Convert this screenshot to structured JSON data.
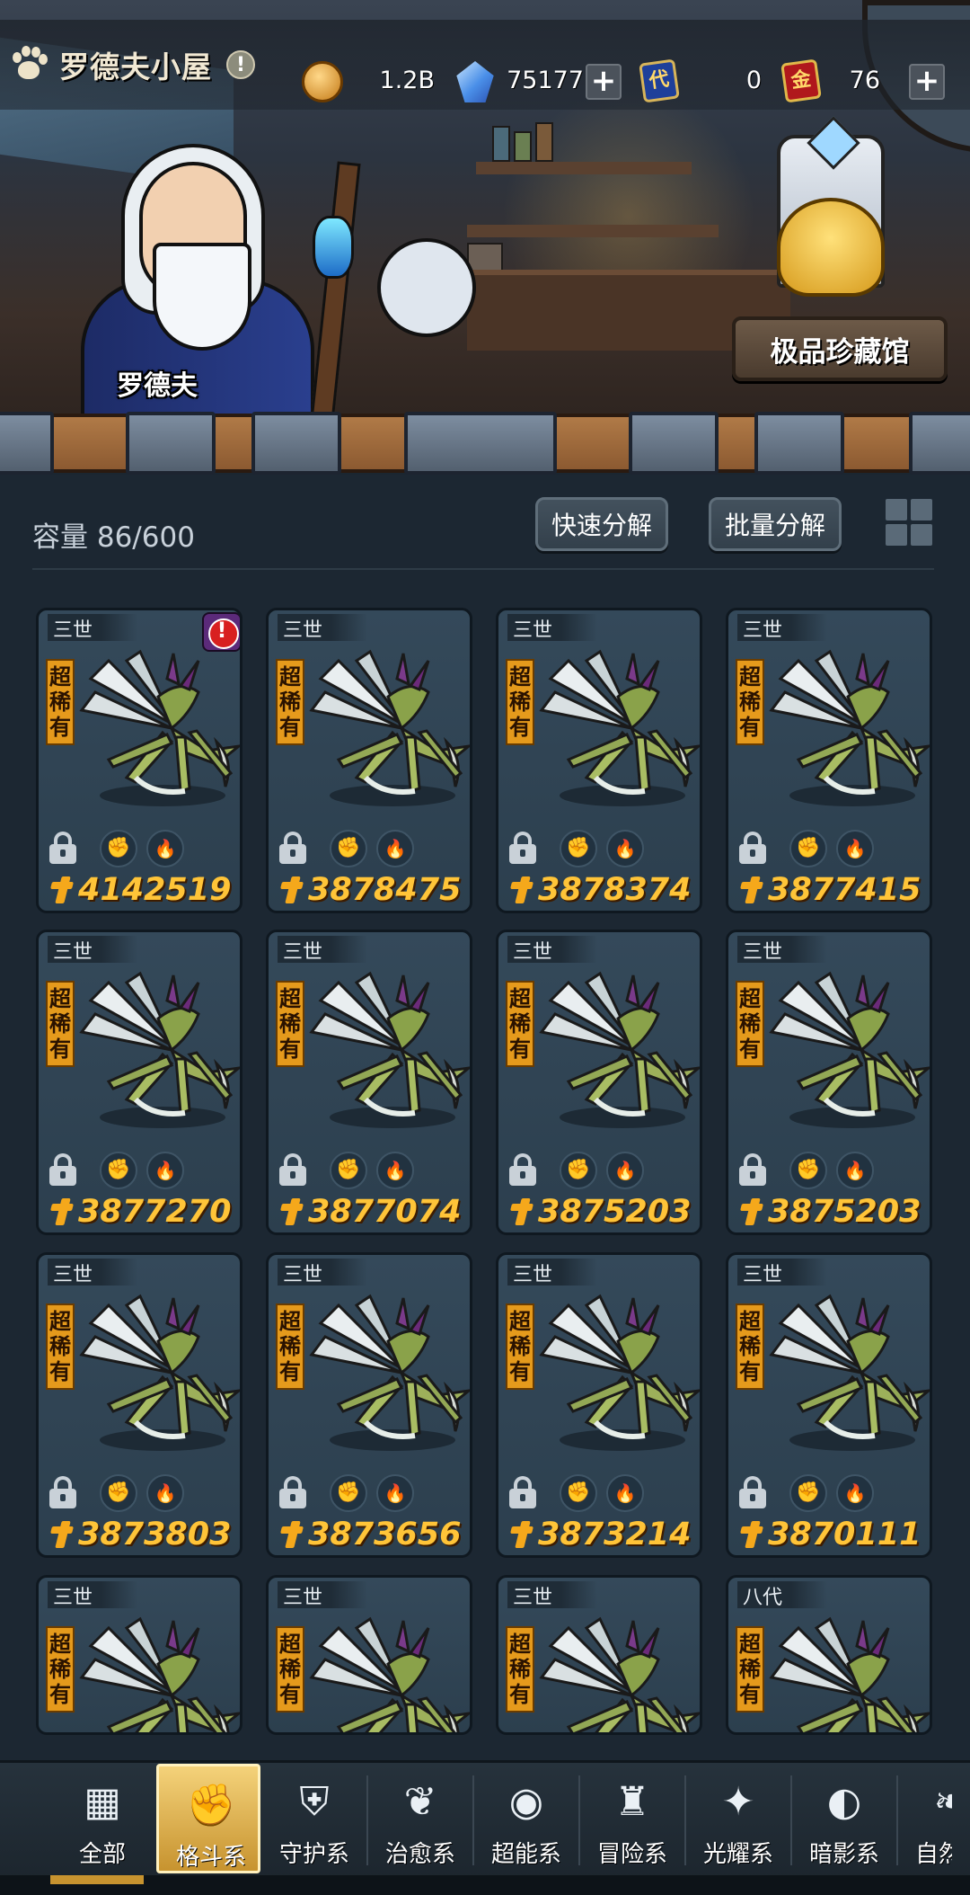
{
  "header": {
    "title": "罗德夫小屋",
    "resources": [
      {
        "icon": "gold-coin-icon",
        "value": "1.2B",
        "has_plus": false
      },
      {
        "icon": "crystal-icon",
        "value": "75177",
        "has_plus": true
      },
      {
        "icon": "blue-ticket-icon",
        "glyph": "代",
        "value": "0",
        "has_plus": false
      },
      {
        "icon": "gold-ticket-icon",
        "glyph": "金",
        "value": "76",
        "has_plus": true
      }
    ]
  },
  "scene": {
    "npc_name": "罗德夫",
    "museum_label": "极品珍藏馆"
  },
  "storage": {
    "capacity_label": "容量 86/600",
    "quick_decompose": "快速分解",
    "batch_decompose": "批量分解"
  },
  "cards": [
    {
      "gen": "三世",
      "rarity": "超稀有",
      "power": "4142519",
      "alert": true
    },
    {
      "gen": "三世",
      "rarity": "超稀有",
      "power": "3878475",
      "alert": false
    },
    {
      "gen": "三世",
      "rarity": "超稀有",
      "power": "3878374",
      "alert": false
    },
    {
      "gen": "三世",
      "rarity": "超稀有",
      "power": "3877415",
      "alert": false
    },
    {
      "gen": "三世",
      "rarity": "超稀有",
      "power": "3877270",
      "alert": false
    },
    {
      "gen": "三世",
      "rarity": "超稀有",
      "power": "3877074",
      "alert": false
    },
    {
      "gen": "三世",
      "rarity": "超稀有",
      "power": "3875203",
      "alert": false
    },
    {
      "gen": "三世",
      "rarity": "超稀有",
      "power": "3875203",
      "alert": false
    },
    {
      "gen": "三世",
      "rarity": "超稀有",
      "power": "3873803",
      "alert": false
    },
    {
      "gen": "三世",
      "rarity": "超稀有",
      "power": "3873656",
      "alert": false
    },
    {
      "gen": "三世",
      "rarity": "超稀有",
      "power": "3873214",
      "alert": false
    },
    {
      "gen": "三世",
      "rarity": "超稀有",
      "power": "3870111",
      "alert": false
    },
    {
      "gen": "三世",
      "rarity": "超稀有",
      "power": "",
      "alert": false
    },
    {
      "gen": "三世",
      "rarity": "超稀有",
      "power": "",
      "alert": false
    },
    {
      "gen": "三世",
      "rarity": "超稀有",
      "power": "",
      "alert": false
    },
    {
      "gen": "八代",
      "rarity": "超稀有",
      "power": "",
      "alert": false
    }
  ],
  "tabs": [
    {
      "label": "全部",
      "icon": "blocks-icon",
      "active": false
    },
    {
      "label": "格斗系",
      "icon": "fist-icon",
      "active": true
    },
    {
      "label": "守护系",
      "icon": "shield-icon",
      "active": false
    },
    {
      "label": "治愈系",
      "icon": "sprout-icon",
      "active": false
    },
    {
      "label": "超能系",
      "icon": "alien-icon",
      "active": false
    },
    {
      "label": "冒险系",
      "icon": "flame-badge-icon",
      "active": false
    },
    {
      "label": "光耀系",
      "icon": "star-cross-icon",
      "active": false
    },
    {
      "label": "暗影系",
      "icon": "eclipse-icon",
      "active": false
    },
    {
      "label": "自然系",
      "icon": "leaf-icon",
      "active": false
    }
  ],
  "colors": {
    "panel_bg": "#1c2732",
    "card_bg": "#34495a",
    "power_text": "#ffc438",
    "rarity_badge": "#e59a1c",
    "active_tab": "#f4d27a"
  }
}
